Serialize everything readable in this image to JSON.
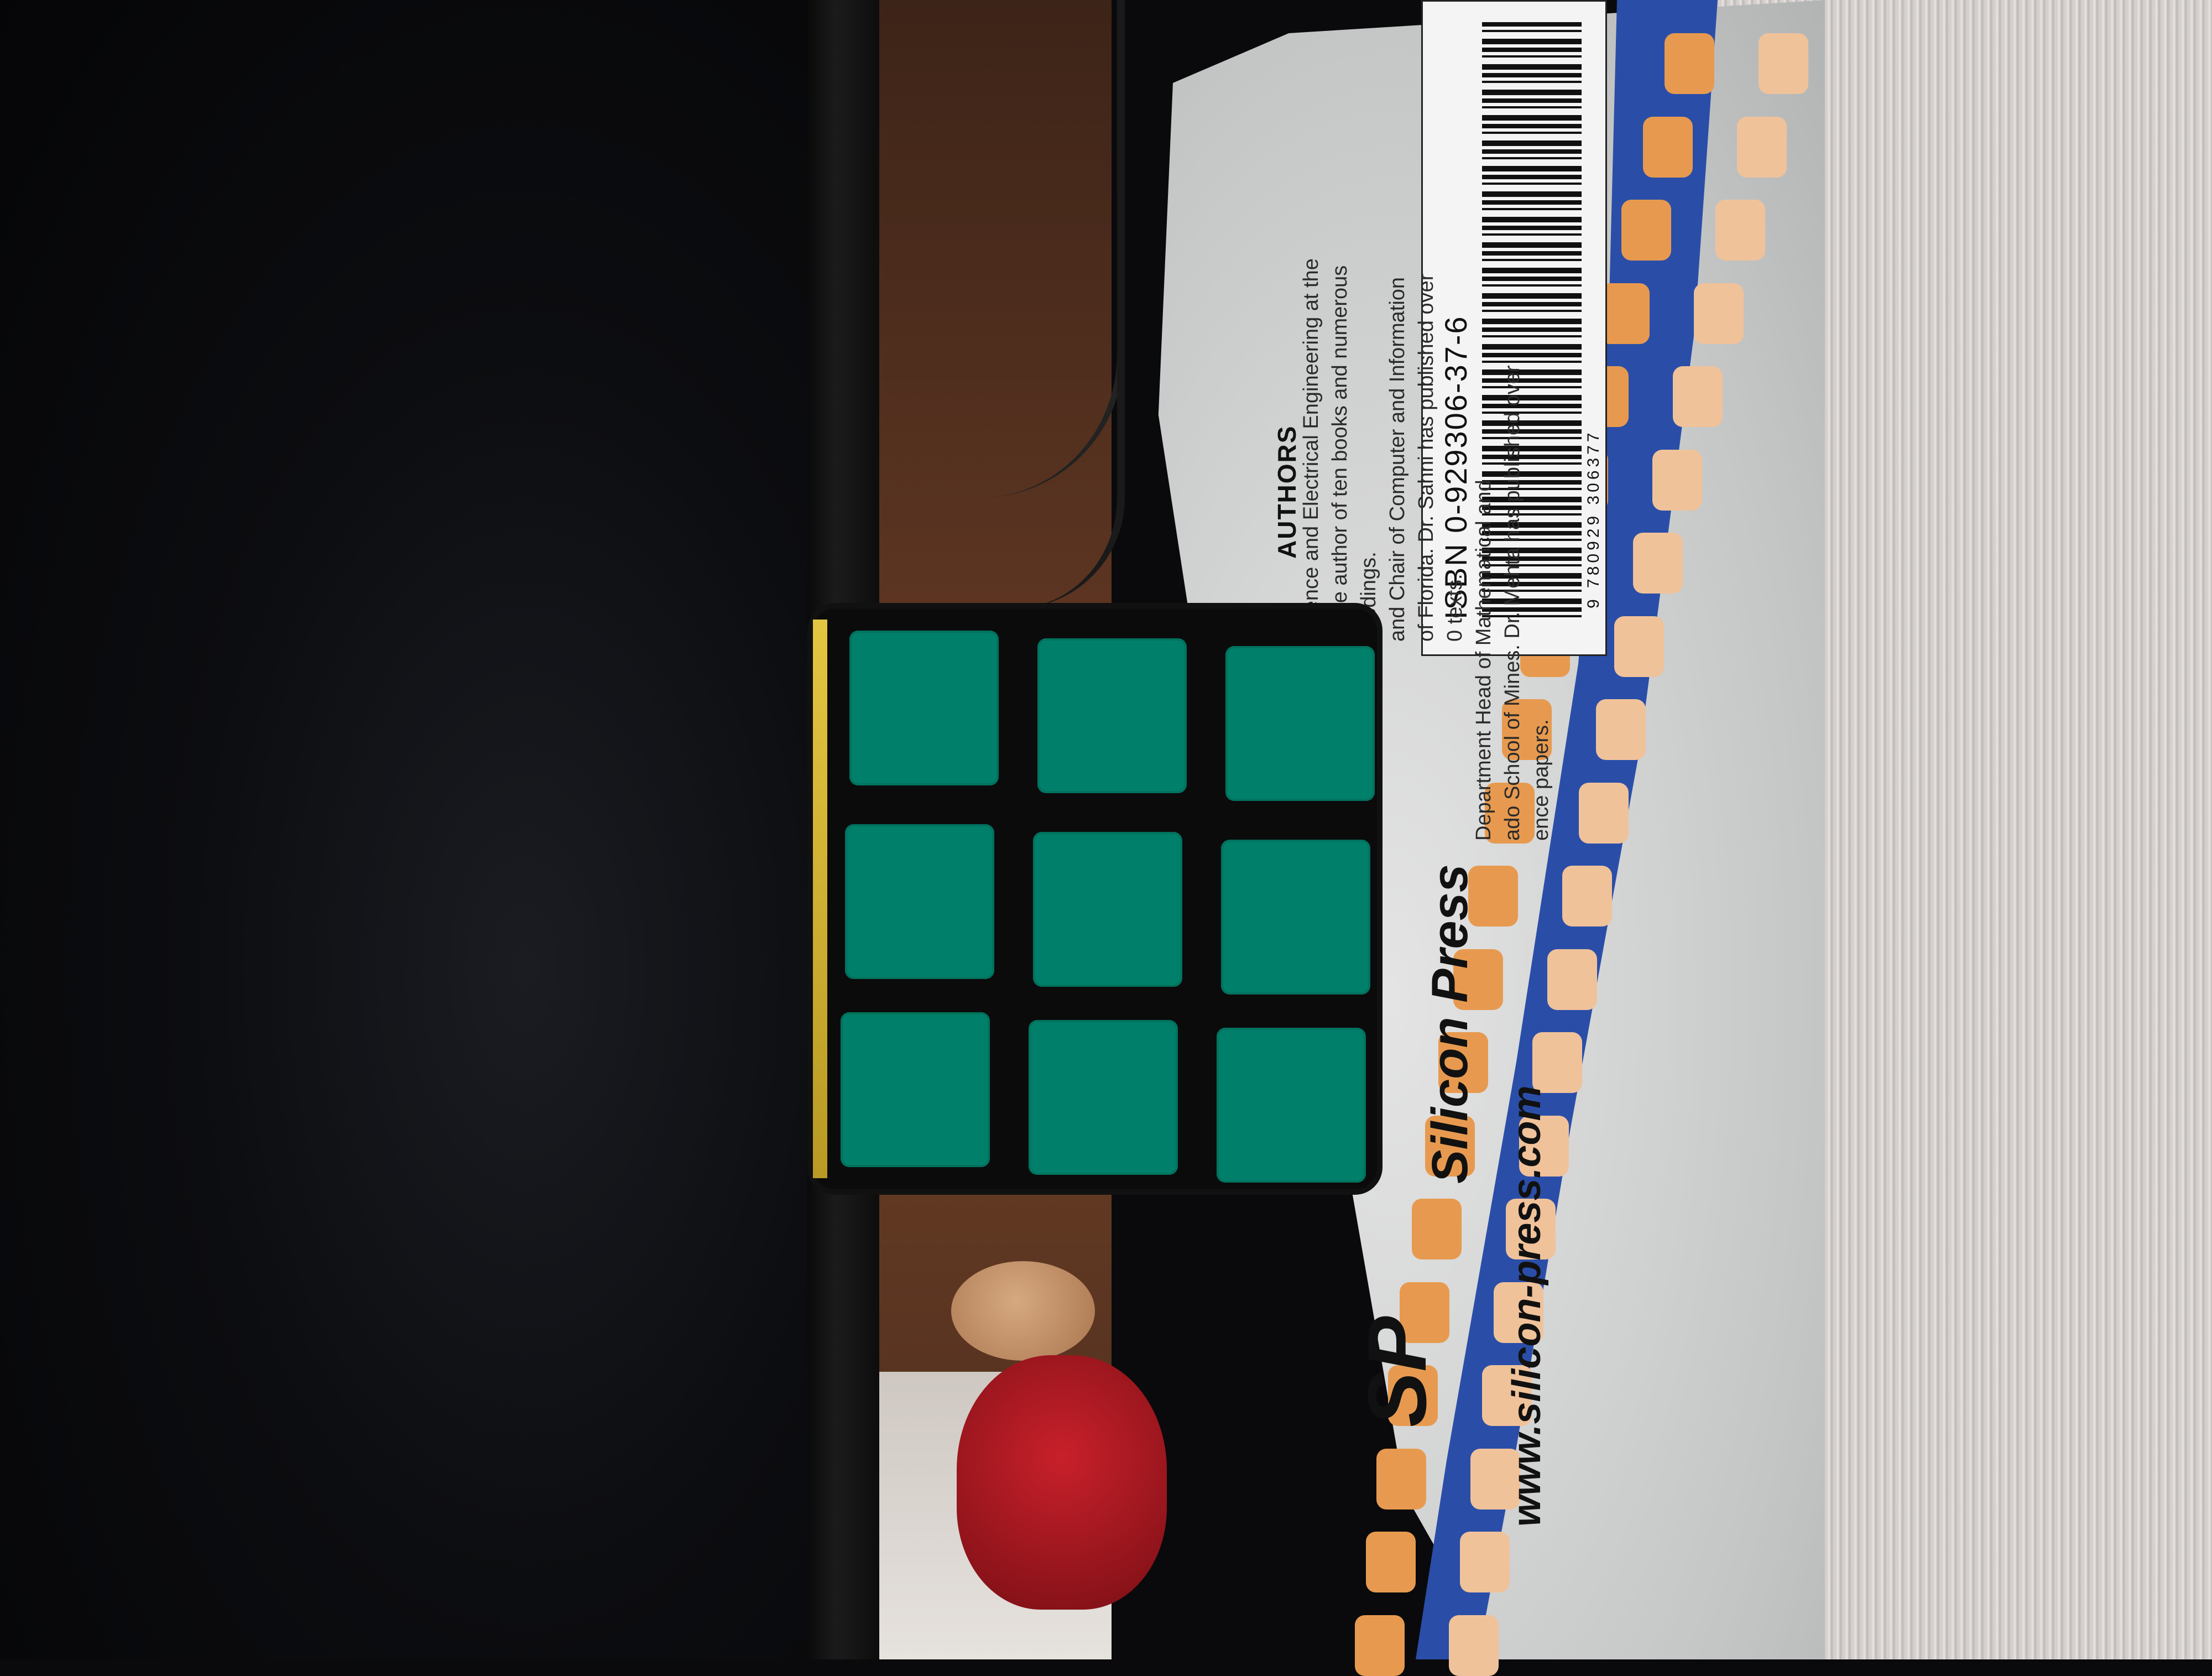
{
  "scene": {
    "description_tags": [
      "rubiks-cube",
      "book",
      "monitor",
      "desk"
    ],
    "cube_face_color": "#00806a",
    "cube_body_color": "#0b0b0b",
    "cover_band_color": "#2a4ea8",
    "cover_pip_color": "#e79a4f"
  },
  "book": {
    "authors_heading": "AUTHORS",
    "author_lines": [
      "Science and Electrical Engineering at the",
      "is the author of ten books and numerous",
      "ceedings.",
      "and Chair of Computer and Information",
      "of Florida. Dr. Sahni has published over",
      "0 texts.",
      "Department Head of Mathematical and",
      "ado School of Mines. Dr. Mehta has published over",
      "ence papers."
    ],
    "isbn": "ISBN 0-929306-37-6",
    "isbn_digits": "9 780929 306377",
    "publisher": "Silicon Press",
    "publisher_url": "www.silicon-press.com",
    "logo": "SP"
  }
}
